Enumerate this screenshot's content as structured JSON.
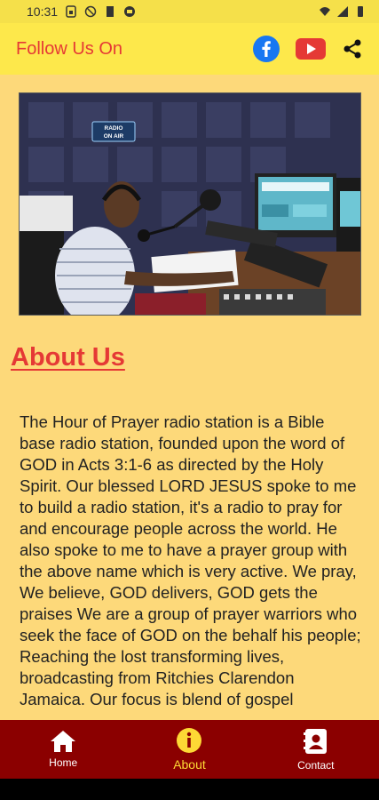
{
  "status_bar": {
    "time": "10:31"
  },
  "app_bar": {
    "follow_label": "Follow Us On",
    "icons": [
      "facebook-icon",
      "youtube-icon",
      "share-icon"
    ]
  },
  "hero": {
    "sign_text": "RADIO ON AIR"
  },
  "about": {
    "title": "About Us",
    "body": "The Hour of Prayer radio station is a Bible base radio station, founded upon the word of GOD in Acts 3:1-6 as directed by the Holy Spirit. Our blessed LORD JESUS spoke to me to build a radio station, it's a radio to pray for and encourage people across the world. He also spoke to me to have a prayer group with the above name which is very active. We pray, We believe, GOD delivers, GOD gets the praises We are a group of prayer warriors who seek the face of GOD on the behalf his people; Reaching the lost transforming lives, broadcasting from Ritchies Clarendon Jamaica. Our focus is blend of gospel"
  },
  "nav": {
    "home": "Home",
    "about": "About",
    "contact": "Contact"
  },
  "colors": {
    "accent": "#e53935",
    "nav_bg": "#8b0000",
    "active": "#fdd835",
    "page_bg": "#fdd97a",
    "bar_bg": "#fde84b"
  }
}
